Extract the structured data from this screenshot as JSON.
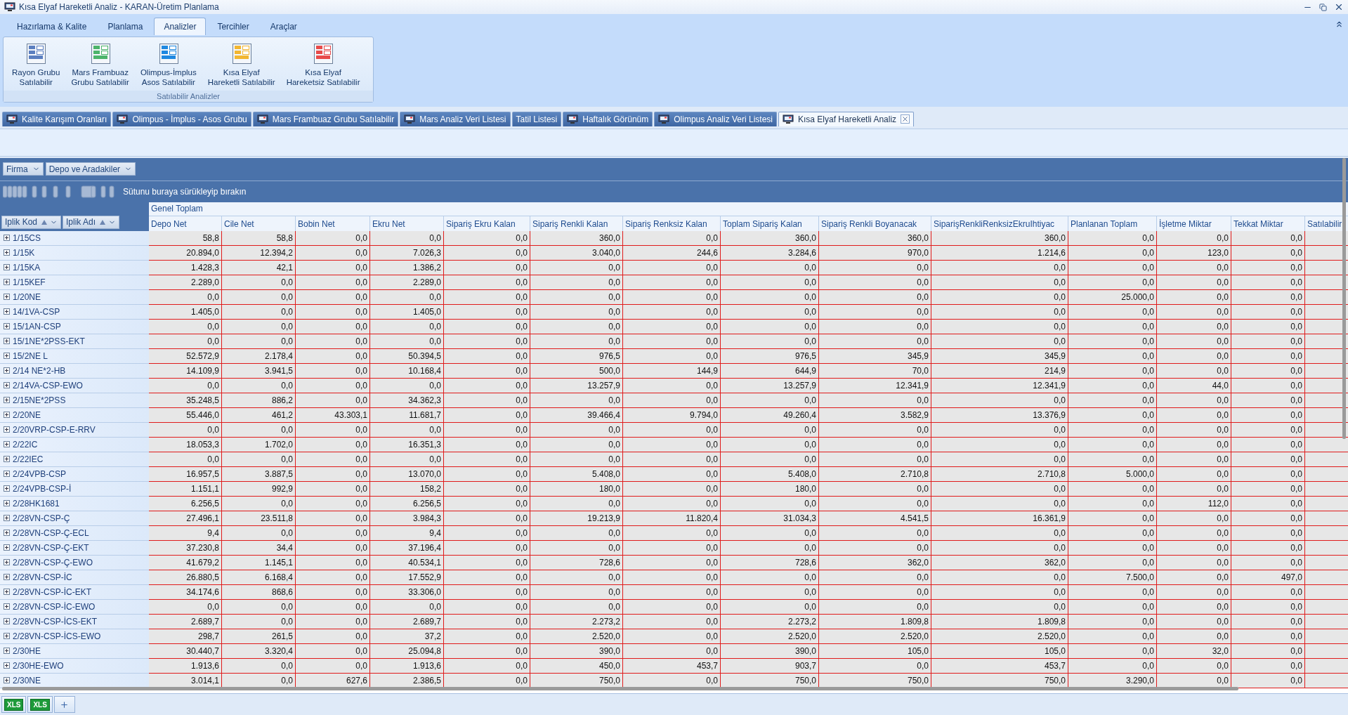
{
  "window": {
    "title": "Kısa Elyaf Hareketli Analiz - KARAN-Üretim Planlama"
  },
  "ribbon_tabs": [
    {
      "label": "Hazırlama & Kalite",
      "selected": false
    },
    {
      "label": "Planlama",
      "selected": false
    },
    {
      "label": "Analizler",
      "selected": true
    },
    {
      "label": "Tercihler",
      "selected": false
    },
    {
      "label": "Araçlar",
      "selected": false
    }
  ],
  "ribbon_group": {
    "title": "Satılabilir Analizler",
    "buttons": [
      {
        "lines": [
          "Rayon Grubu",
          "Satılabilir"
        ],
        "color": "#5b7fc0"
      },
      {
        "lines": [
          "Mars Frambuaz",
          "Grubu Satılabilir"
        ],
        "color": "#4cb46a"
      },
      {
        "lines": [
          "Olimpus-İmplus",
          "Asos Satılabilir"
        ],
        "color": "#1e88e0"
      },
      {
        "lines": [
          "Kısa Elyaf",
          "Hareketli Satılabilir"
        ],
        "color": "#f2b630"
      },
      {
        "lines": [
          "Kısa Elyaf",
          "Hareketsiz Satılabilir"
        ],
        "color": "#e84a4a"
      }
    ]
  },
  "document_tabs": [
    {
      "label": "Kalite Karışım Oranları",
      "selected": false
    },
    {
      "label": "Olimpus - İmplus - Asos Grubu",
      "selected": false
    },
    {
      "label": "Mars Frambuaz Grubu Satılabilir",
      "selected": false
    },
    {
      "label": "Mars Analiz Veri Listesi",
      "selected": false
    },
    {
      "label": "Tatil Listesi",
      "selected": false,
      "no_icon": true
    },
    {
      "label": "Haftalık Görünüm",
      "selected": false
    },
    {
      "label": "Olimpus Analiz Veri Listesi",
      "selected": false
    },
    {
      "label": "Kısa Elyaf Hareketli Analiz",
      "selected": true
    }
  ],
  "filter_fields": [
    "Firma",
    "Depo ve Aradakiler"
  ],
  "group_area": {
    "hint": "Sütunu buraya sürükleyip bırakın"
  },
  "row_fields": [
    "Iplik Kod",
    "Iplik Adı"
  ],
  "grand_total_header": "Genel Toplam",
  "columns": [
    "Depo Net",
    "Cile Net",
    "Bobin Net",
    "Ekru Net",
    "Sipariş Ekru Kalan",
    "Sipariş Renkli Kalan",
    "Sipariş Renksiz Kalan",
    "Toplam Sipariş Kalan",
    "Sipariş Renkli Boyanacak",
    "SiparişRenkliRenksizEkruIhtiyac",
    "Planlanan Toplam",
    "İşletme Miktar",
    "Tekkat Miktar",
    "Satılabilir"
  ],
  "rows": [
    {
      "label": "1/15CS",
      "cells": [
        "58,8",
        "58,8",
        "0,0",
        "0,0",
        "0,0",
        "360,0",
        "0,0",
        "360,0",
        "360,0",
        "360,0",
        "0,0",
        "0,0",
        "0,0"
      ]
    },
    {
      "label": "1/15K",
      "cells": [
        "20.894,0",
        "12.394,2",
        "0,0",
        "7.026,3",
        "0,0",
        "3.040,0",
        "244,6",
        "3.284,6",
        "970,0",
        "1.214,6",
        "0,0",
        "123,0",
        "0,0"
      ]
    },
    {
      "label": "1/15KA",
      "cells": [
        "1.428,3",
        "42,1",
        "0,0",
        "1.386,2",
        "0,0",
        "0,0",
        "0,0",
        "0,0",
        "0,0",
        "0,0",
        "0,0",
        "0,0",
        "0,0"
      ]
    },
    {
      "label": "1/15KEF",
      "cells": [
        "2.289,0",
        "0,0",
        "0,0",
        "2.289,0",
        "0,0",
        "0,0",
        "0,0",
        "0,0",
        "0,0",
        "0,0",
        "0,0",
        "0,0",
        "0,0"
      ]
    },
    {
      "label": "1/20NE",
      "cells": [
        "0,0",
        "0,0",
        "0,0",
        "0,0",
        "0,0",
        "0,0",
        "0,0",
        "0,0",
        "0,0",
        "0,0",
        "25.000,0",
        "0,0",
        "0,0"
      ]
    },
    {
      "label": "14/1VA-CSP",
      "cells": [
        "1.405,0",
        "0,0",
        "0,0",
        "1.405,0",
        "0,0",
        "0,0",
        "0,0",
        "0,0",
        "0,0",
        "0,0",
        "0,0",
        "0,0",
        "0,0"
      ]
    },
    {
      "label": "15/1AN-CSP",
      "cells": [
        "0,0",
        "0,0",
        "0,0",
        "0,0",
        "0,0",
        "0,0",
        "0,0",
        "0,0",
        "0,0",
        "0,0",
        "0,0",
        "0,0",
        "0,0"
      ]
    },
    {
      "label": "15/1NE*2PSS-EKT",
      "cells": [
        "0,0",
        "0,0",
        "0,0",
        "0,0",
        "0,0",
        "0,0",
        "0,0",
        "0,0",
        "0,0",
        "0,0",
        "0,0",
        "0,0",
        "0,0"
      ]
    },
    {
      "label": "15/2NE L",
      "cells": [
        "52.572,9",
        "2.178,4",
        "0,0",
        "50.394,5",
        "0,0",
        "976,5",
        "0,0",
        "976,5",
        "345,9",
        "345,9",
        "0,0",
        "0,0",
        "0,0"
      ]
    },
    {
      "label": "2/14 NE*2-HB",
      "cells": [
        "14.109,9",
        "3.941,5",
        "0,0",
        "10.168,4",
        "0,0",
        "500,0",
        "144,9",
        "644,9",
        "70,0",
        "214,9",
        "0,0",
        "0,0",
        "0,0"
      ]
    },
    {
      "label": "2/14VA-CSP-EWO",
      "cells": [
        "0,0",
        "0,0",
        "0,0",
        "0,0",
        "0,0",
        "13.257,9",
        "0,0",
        "13.257,9",
        "12.341,9",
        "12.341,9",
        "0,0",
        "44,0",
        "0,0"
      ]
    },
    {
      "label": "2/15NE*2PSS",
      "cells": [
        "35.248,5",
        "886,2",
        "0,0",
        "34.362,3",
        "0,0",
        "0,0",
        "0,0",
        "0,0",
        "0,0",
        "0,0",
        "0,0",
        "0,0",
        "0,0"
      ]
    },
    {
      "label": "2/20NE",
      "cells": [
        "55.446,0",
        "461,2",
        "43.303,1",
        "11.681,7",
        "0,0",
        "39.466,4",
        "9.794,0",
        "49.260,4",
        "3.582,9",
        "13.376,9",
        "0,0",
        "0,0",
        "0,0"
      ]
    },
    {
      "label": "2/20VRP-CSP-E-RRV",
      "cells": [
        "0,0",
        "0,0",
        "0,0",
        "0,0",
        "0,0",
        "0,0",
        "0,0",
        "0,0",
        "0,0",
        "0,0",
        "0,0",
        "0,0",
        "0,0"
      ]
    },
    {
      "label": "2/22IC",
      "cells": [
        "18.053,3",
        "1.702,0",
        "0,0",
        "16.351,3",
        "0,0",
        "0,0",
        "0,0",
        "0,0",
        "0,0",
        "0,0",
        "0,0",
        "0,0",
        "0,0"
      ]
    },
    {
      "label": "2/22IEC",
      "cells": [
        "0,0",
        "0,0",
        "0,0",
        "0,0",
        "0,0",
        "0,0",
        "0,0",
        "0,0",
        "0,0",
        "0,0",
        "0,0",
        "0,0",
        "0,0"
      ]
    },
    {
      "label": "2/24VPB-CSP",
      "cells": [
        "16.957,5",
        "3.887,5",
        "0,0",
        "13.070,0",
        "0,0",
        "5.408,0",
        "0,0",
        "5.408,0",
        "2.710,8",
        "2.710,8",
        "5.000,0",
        "0,0",
        "0,0"
      ]
    },
    {
      "label": "2/24VPB-CSP-İ",
      "cells": [
        "1.151,1",
        "992,9",
        "0,0",
        "158,2",
        "0,0",
        "180,0",
        "0,0",
        "180,0",
        "0,0",
        "0,0",
        "0,0",
        "0,0",
        "0,0"
      ]
    },
    {
      "label": "2/28HK1681",
      "cells": [
        "6.256,5",
        "0,0",
        "0,0",
        "6.256,5",
        "0,0",
        "0,0",
        "0,0",
        "0,0",
        "0,0",
        "0,0",
        "0,0",
        "112,0",
        "0,0"
      ]
    },
    {
      "label": "2/28VN-CSP-Ç",
      "cells": [
        "27.496,1",
        "23.511,8",
        "0,0",
        "3.984,3",
        "0,0",
        "19.213,9",
        "11.820,4",
        "31.034,3",
        "4.541,5",
        "16.361,9",
        "0,0",
        "0,0",
        "0,0"
      ]
    },
    {
      "label": "2/28VN-CSP-Ç-ECL",
      "cells": [
        "9,4",
        "0,0",
        "0,0",
        "9,4",
        "0,0",
        "0,0",
        "0,0",
        "0,0",
        "0,0",
        "0,0",
        "0,0",
        "0,0",
        "0,0"
      ]
    },
    {
      "label": "2/28VN-CSP-Ç-EKT",
      "cells": [
        "37.230,8",
        "34,4",
        "0,0",
        "37.196,4",
        "0,0",
        "0,0",
        "0,0",
        "0,0",
        "0,0",
        "0,0",
        "0,0",
        "0,0",
        "0,0"
      ]
    },
    {
      "label": "2/28VN-CSP-Ç-EWO",
      "cells": [
        "41.679,2",
        "1.145,1",
        "0,0",
        "40.534,1",
        "0,0",
        "728,6",
        "0,0",
        "728,6",
        "362,0",
        "362,0",
        "0,0",
        "0,0",
        "0,0"
      ]
    },
    {
      "label": "2/28VN-CSP-İC",
      "cells": [
        "26.880,5",
        "6.168,4",
        "0,0",
        "17.552,9",
        "0,0",
        "0,0",
        "0,0",
        "0,0",
        "0,0",
        "0,0",
        "7.500,0",
        "0,0",
        "497,0"
      ]
    },
    {
      "label": "2/28VN-CSP-İC-EKT",
      "cells": [
        "34.174,6",
        "868,6",
        "0,0",
        "33.306,0",
        "0,0",
        "0,0",
        "0,0",
        "0,0",
        "0,0",
        "0,0",
        "0,0",
        "0,0",
        "0,0"
      ]
    },
    {
      "label": "2/28VN-CSP-İC-EWO",
      "cells": [
        "0,0",
        "0,0",
        "0,0",
        "0,0",
        "0,0",
        "0,0",
        "0,0",
        "0,0",
        "0,0",
        "0,0",
        "0,0",
        "0,0",
        "0,0"
      ]
    },
    {
      "label": "2/28VN-CSP-İCS-EKT",
      "cells": [
        "2.689,7",
        "0,0",
        "0,0",
        "2.689,7",
        "0,0",
        "2.273,2",
        "0,0",
        "2.273,2",
        "1.809,8",
        "1.809,8",
        "0,0",
        "0,0",
        "0,0"
      ]
    },
    {
      "label": "2/28VN-CSP-İCS-EWO",
      "cells": [
        "298,7",
        "261,5",
        "0,0",
        "37,2",
        "0,0",
        "2.520,0",
        "0,0",
        "2.520,0",
        "2.520,0",
        "2.520,0",
        "0,0",
        "0,0",
        "0,0"
      ]
    },
    {
      "label": "2/30HE",
      "cells": [
        "30.440,7",
        "3.320,4",
        "0,0",
        "25.094,8",
        "0,0",
        "390,0",
        "0,0",
        "390,0",
        "105,0",
        "105,0",
        "0,0",
        "32,0",
        "0,0"
      ]
    },
    {
      "label": "2/30HE-EWO",
      "cells": [
        "1.913,6",
        "0,0",
        "0,0",
        "1.913,6",
        "0,0",
        "450,0",
        "453,7",
        "903,7",
        "0,0",
        "453,7",
        "0,0",
        "0,0",
        "0,0"
      ]
    },
    {
      "label": "2/30NE",
      "cells": [
        "3.014,1",
        "0,0",
        "627,6",
        "2.386,5",
        "0,0",
        "750,0",
        "0,0",
        "750,0",
        "750,0",
        "750,0",
        "3.290,0",
        "0,0",
        "0,0"
      ]
    }
  ],
  "bottom_buttons": [
    "XLS",
    "XLS"
  ]
}
